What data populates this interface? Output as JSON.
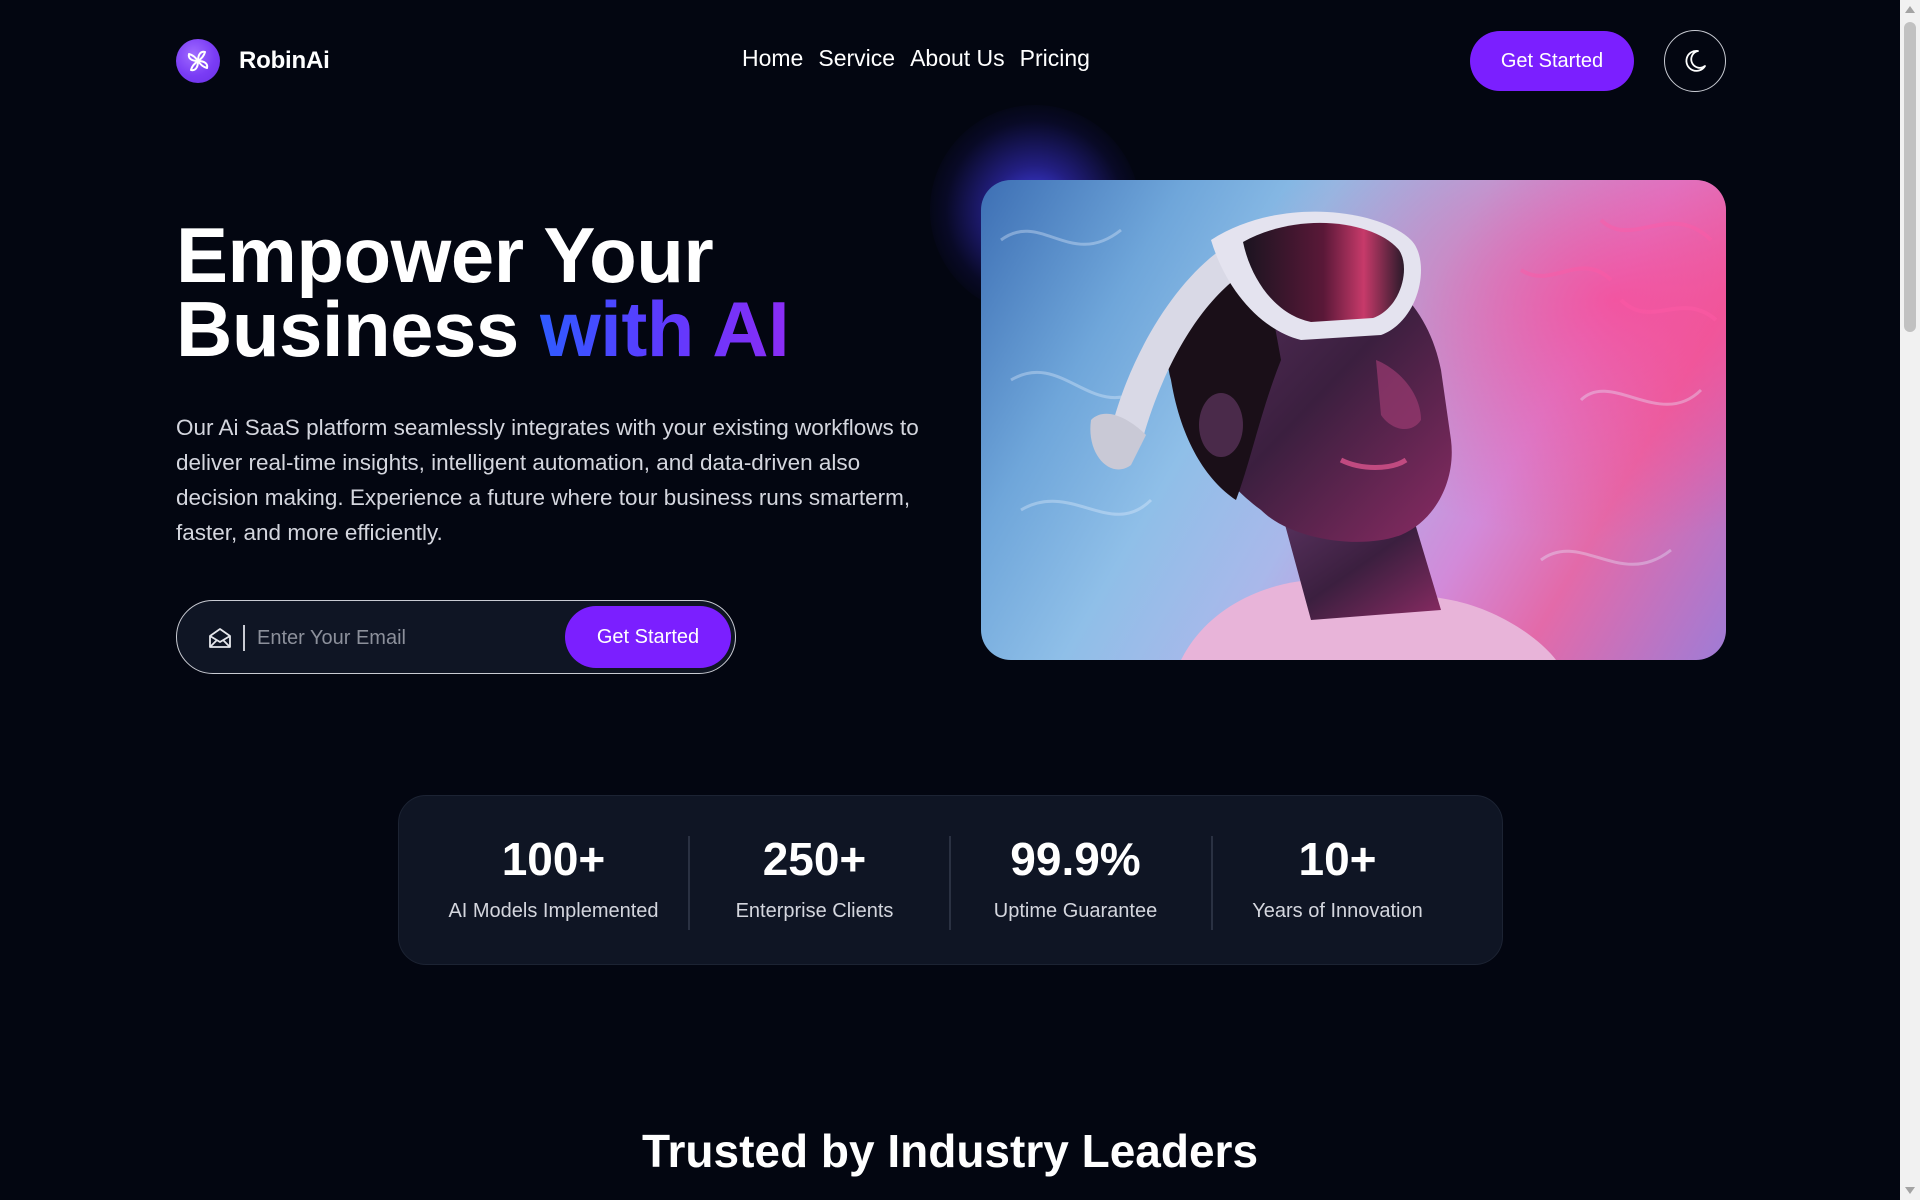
{
  "brand": {
    "name": "RobinAi",
    "logo_icon": "fan-logo-icon"
  },
  "nav": {
    "links": [
      "Home",
      "Service",
      "About Us",
      "Pricing"
    ],
    "cta_label": "Get Started",
    "theme_toggle_icon": "moon-icon"
  },
  "hero": {
    "title_line1": "Empower Your",
    "title_line2_plain": "Business ",
    "title_line2_accent": "with AI",
    "description": "Our Ai SaaS platform seamlessly integrates with your existing workflows to deliver real-time insights, intelligent automation, and data-driven also decision making. Experience a future where tour business runs smarterm, faster, and more efficiently.",
    "email_placeholder": "Enter Your Email",
    "email_value": "",
    "cta_label": "Get Started",
    "image_subject": "person-wearing-vr-headset"
  },
  "stats": [
    {
      "value": "100+",
      "label": "AI Models Implemented"
    },
    {
      "value": "250+",
      "label": "Enterprise Clients"
    },
    {
      "value": "99.9%",
      "label": "Uptime Guarantee"
    },
    {
      "value": "10+",
      "label": "Years of Innovation"
    }
  ],
  "trusted": {
    "title": "Trusted by Industry Leaders"
  },
  "colors": {
    "background": "#030611",
    "accent": "#7b1fff",
    "accent_gradient_start": "#2f5bff",
    "accent_gradient_end": "#8b2cf5",
    "card": "#0f1524"
  }
}
